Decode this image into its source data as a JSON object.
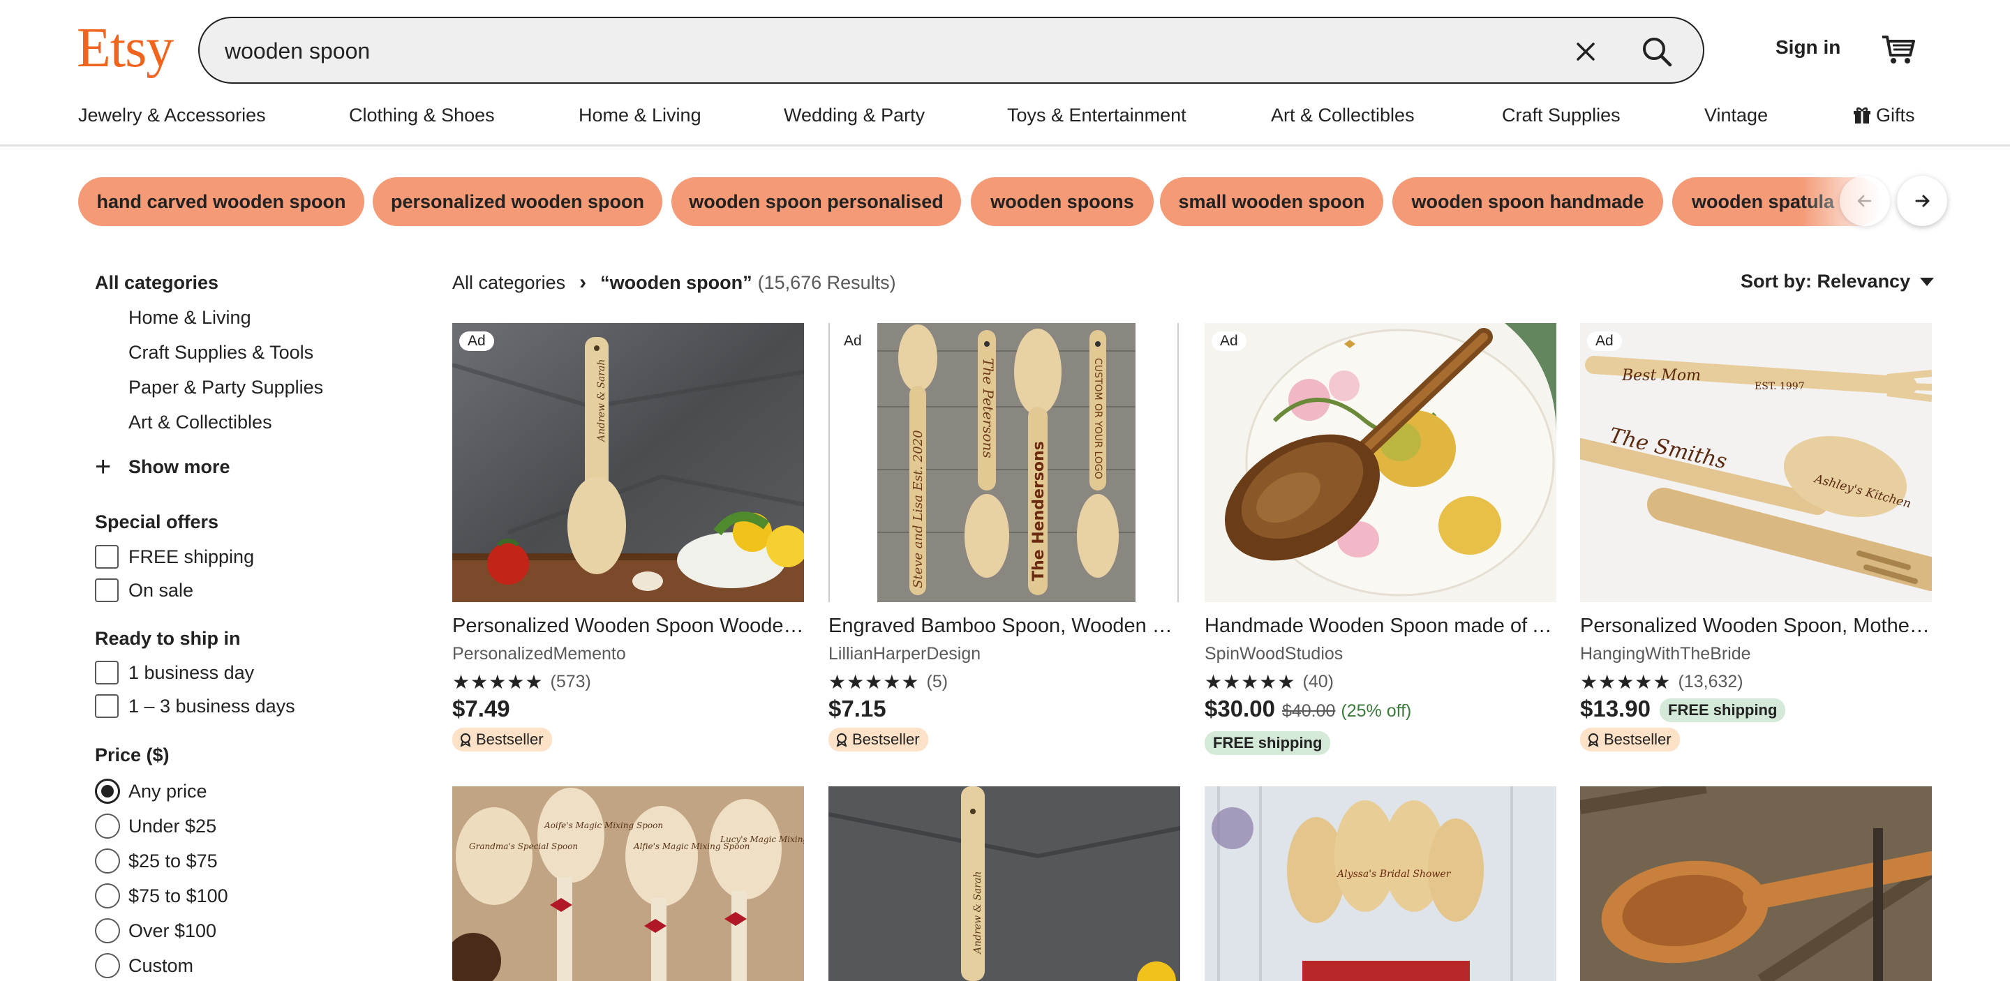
{
  "header": {
    "logo": "Etsy",
    "search_value": "wooden spoon",
    "sign_in": "Sign in"
  },
  "nav": [
    "Jewelry & Accessories",
    "Clothing & Shoes",
    "Home & Living",
    "Wedding & Party",
    "Toys & Entertainment",
    "Art & Collectibles",
    "Craft Supplies",
    "Vintage",
    "Gifts"
  ],
  "chips": [
    "hand carved wooden spoon",
    "personalized wooden spoon",
    "wooden spoon personalised",
    "wooden spoons",
    "small wooden spoon",
    "wooden spoon handmade",
    "wooden spatula"
  ],
  "sidebar": {
    "all_categories": "All categories",
    "categories": [
      "Home & Living",
      "Craft Supplies & Tools",
      "Paper & Party Supplies",
      "Art & Collectibles"
    ],
    "show_more": "Show more",
    "special_offers": {
      "title": "Special offers",
      "options": [
        "FREE shipping",
        "On sale"
      ]
    },
    "ready_to_ship": {
      "title": "Ready to ship in",
      "options": [
        "1 business day",
        "1 – 3 business days"
      ]
    },
    "price": {
      "title": "Price ($)",
      "options": [
        "Any price",
        "Under $25",
        "$25 to $75",
        "$75 to $100",
        "Over $100",
        "Custom"
      ],
      "selected": "Any price"
    }
  },
  "results": {
    "breadcrumb_root": "All categories",
    "query": "“wooden spoon”",
    "count": "(15,676 Results)",
    "sort_label": "Sort by: Relevancy"
  },
  "listings": [
    {
      "ad": "Ad",
      "title": "Personalized Wooden Spoon Wooden Spoon Anniversary Gift",
      "shop": "PersonalizedMemento",
      "stars": "★★★★★",
      "reviews": "(573)",
      "price": "$7.49",
      "bestseller": "Bestseller"
    },
    {
      "ad": "Ad",
      "title": "Engraved Bamboo Spoon, Wooden Spoon Personalized",
      "shop": "LillianHarperDesign",
      "stars": "★★★★★",
      "reviews": "(5)",
      "price": "$7.15",
      "bestseller": "Bestseller"
    },
    {
      "ad": "Ad",
      "title": "Handmade Wooden Spoon made of Apple Wood",
      "shop": "SpinWoodStudios",
      "stars": "★★★★★",
      "reviews": "(40)",
      "price": "$30.00",
      "original_price": "$40.00",
      "discount": "(25% off)",
      "free_shipping": "FREE shipping"
    },
    {
      "ad": "Ad",
      "title": "Personalized Wooden Spoon, Mother's Day Gift",
      "shop": "HangingWithTheBride",
      "stars": "★★★★★",
      "reviews": "(13,632)",
      "price": "$13.90",
      "free_shipping": "FREE shipping",
      "bestseller": "Bestseller"
    }
  ],
  "image_text": {
    "spoon1": "Andrew & Sarah",
    "spoon2a": "Steve and Lisa Est. 2020",
    "spoon2b": "The Petersons",
    "spoon2c": "The Hendersons",
    "spoon2d": "CUSTOM OR YOUR LOGO",
    "spoon4a": "Best Mom",
    "spoon4b": "EST. 1997",
    "spoon4c": "The Smiths",
    "spoon4d": "Ashley's Kitchen",
    "spoon5a": "Grandma's Special Spoon",
    "spoon5b": "Aoife's Magic Mixing Spoon",
    "spoon5c": "Alfie's Magic Mixing Spoon",
    "spoon5d": "Lucy's Magic Mixing Spoon",
    "spoon7a": "Alyssa's Bridal Shower"
  },
  "colors": {
    "brand": "#f1641e",
    "chip": "#f49a76",
    "free_shipping_bg": "#d4e9d7",
    "bestseller_bg": "#fde2c8",
    "discount": "#3c7a3c"
  }
}
